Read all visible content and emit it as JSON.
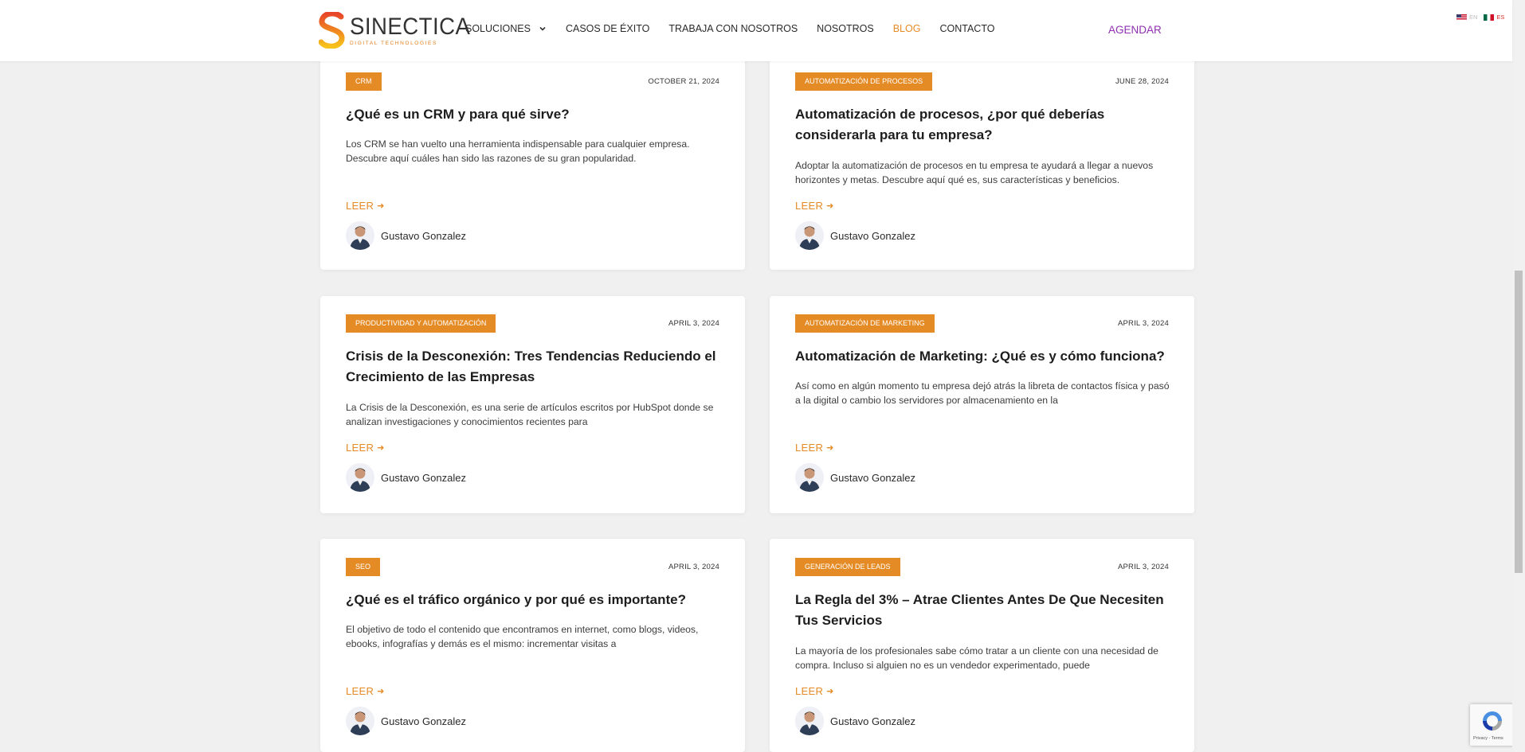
{
  "brand": {
    "name": "SINECTICA",
    "tagline": "DIGITAL TECHNOLOGIES",
    "colors": {
      "orange": "#e58b25",
      "purple": "#8e2fb0"
    }
  },
  "nav": {
    "items": [
      {
        "label": "SOLUCIONES",
        "has_dropdown": true,
        "active": false
      },
      {
        "label": "CASOS DE ÉXITO",
        "active": false
      },
      {
        "label": "TRABAJA CON NOSOTROS",
        "active": false
      },
      {
        "label": "NOSOTROS",
        "active": false
      },
      {
        "label": "BLOG",
        "active": true
      },
      {
        "label": "CONTACTO",
        "active": false
      }
    ],
    "cta": "AGENDAR"
  },
  "language": {
    "en": "EN",
    "es": "ES",
    "selected": "ES"
  },
  "posts": [
    {
      "category": "CRM",
      "date": "OCTOBER 21, 2024",
      "title": "¿Qué es un CRM y para qué sirve?",
      "excerpt": "Los CRM se han vuelto una herramienta indispensable para cualquier empresa. Descubre aquí cuáles han sido las razones de su gran popularidad.",
      "read_label": "LEER",
      "author": "Gustavo Gonzalez"
    },
    {
      "category": "AUTOMATIZACIÓN DE PROCESOS",
      "date": "JUNE 28, 2024",
      "title": "Automatización de procesos, ¿por qué deberías considerarla para tu empresa?",
      "excerpt": "Adoptar la automatización de procesos en tu empresa te ayudará a llegar a nuevos horizontes y metas. Descubre aquí qué es, sus características y beneficios.",
      "read_label": "LEER",
      "author": "Gustavo Gonzalez"
    },
    {
      "category": "PRODUCTIVIDAD Y AUTOMATIZACIÓN",
      "date": "APRIL 3, 2024",
      "title": "Crisis de la Desconexión: Tres Tendencias Reduciendo el Crecimiento de las Empresas",
      "excerpt": "La Crisis de la Desconexión, es una serie de artículos escritos por HubSpot donde se analizan investigaciones y conocimientos recientes para",
      "read_label": "LEER",
      "author": "Gustavo Gonzalez"
    },
    {
      "category": "AUTOMATIZACIÓN DE MARKETING",
      "date": "APRIL 3, 2024",
      "title": "Automatización de Marketing: ¿Qué es y cómo funciona?",
      "excerpt": "Así como en algún momento tu empresa dejó atrás la libreta de contactos física y pasó a la digital o cambio los servidores por almacenamiento en la",
      "read_label": "LEER",
      "author": "Gustavo Gonzalez"
    },
    {
      "category": "SEO",
      "date": "APRIL 3, 2024",
      "title": "¿Qué es el tráfico orgánico y por qué es importante?",
      "excerpt": "El objetivo de todo el contenido que encontramos en internet, como blogs, videos, ebooks, infografías y demás es el mismo: incrementar visitas a",
      "read_label": "LEER",
      "author": "Gustavo Gonzalez"
    },
    {
      "category": "GENERACIÓN DE LEADS",
      "date": "APRIL 3, 2024",
      "title": "La Regla del 3% – Atrae Clientes Antes De Que Necesiten Tus Servicios",
      "excerpt": "La mayoría de los profesionales sabe cómo tratar a un cliente con una necesidad de compra. Incluso si alguien no es un vendedor experimentado, puede",
      "read_label": "LEER",
      "author": "Gustavo Gonzalez"
    }
  ],
  "recaptcha": {
    "links": "Privacy - Terms"
  }
}
